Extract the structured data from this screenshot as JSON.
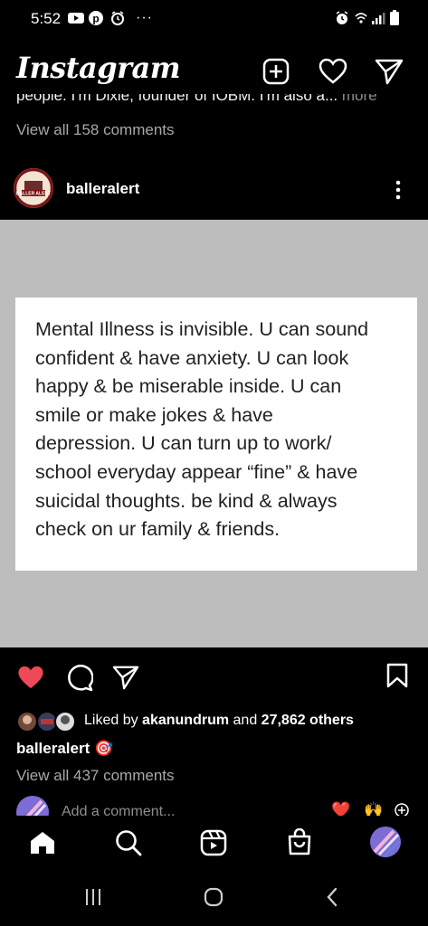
{
  "status_bar": {
    "time": "5:52",
    "icons_left": [
      "youtube-icon",
      "pinterest-icon",
      "clock-app-icon",
      "more-dots-icon"
    ],
    "icons_right": [
      "alarm-icon",
      "wifi-icon",
      "signal-icon",
      "battery-icon"
    ]
  },
  "header": {
    "logo_text": "Instagram",
    "actions": [
      "new-post-icon",
      "heart-icon",
      "direct-message-icon"
    ]
  },
  "previous_post": {
    "caption_fragment": "people. I'm Dixie, founder of IOBM. I'm also a...",
    "more_label": "more",
    "comments_link": "View all 158 comments"
  },
  "post": {
    "username": "balleralert",
    "avatar_text": "BALLER ALERT",
    "image": {
      "background": "#bdbdbd",
      "quote_lines": [
        "Mental Illness is invisible. U can sound",
        "confident & have anxiety. U can look",
        "happy & be miserable inside. U can",
        "smile or make jokes & have",
        "depression. U can turn up to work/",
        "school everyday appear “fine” & have",
        "suicidal thoughts. be kind & always",
        "check on ur family & friends."
      ]
    },
    "liked": true,
    "likes": {
      "prefix": "Liked by",
      "user": "akanundrum",
      "middle": "and",
      "others": "27,862 others"
    },
    "caption_user": "balleralert",
    "caption_emoji": "🎯",
    "comments_link": "View all 437 comments",
    "add_comment_placeholder": "Add a comment...",
    "quick_reactions": [
      "❤️",
      "🙌"
    ]
  },
  "colors": {
    "background": "#000000",
    "like_red": "#ed4956",
    "muted_text": "#a8a8a8"
  },
  "bottom_nav": [
    "home-icon",
    "search-icon",
    "reels-icon",
    "shop-icon",
    "profile-avatar"
  ],
  "system_nav": [
    "recent-apps-icon",
    "home-circle-icon",
    "back-icon"
  ]
}
